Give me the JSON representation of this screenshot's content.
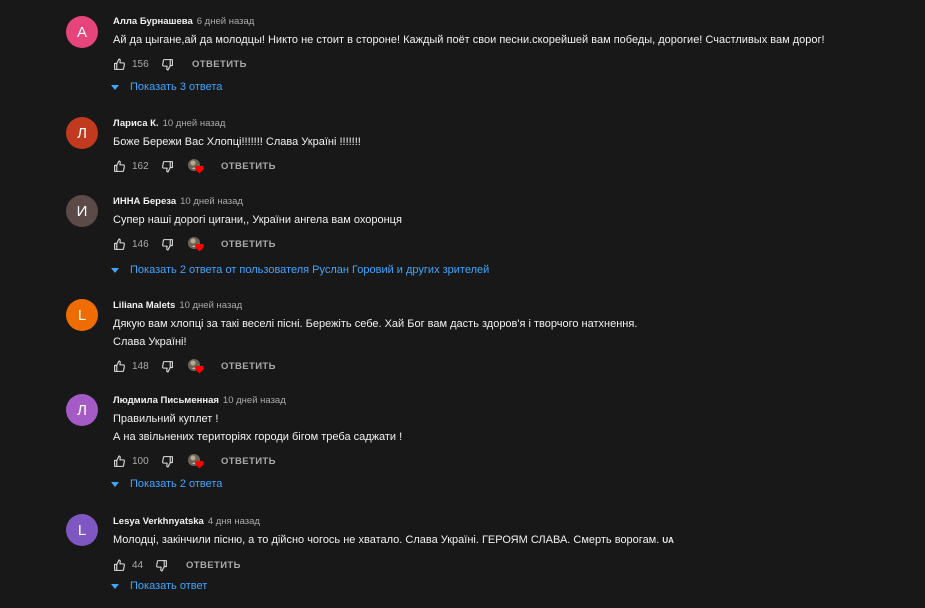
{
  "comments": [
    {
      "initial": "А",
      "avatar_color": "#e5457a",
      "author": "Алла Бурнашева",
      "time": "6 дней назад",
      "lines": [
        "Ай да цыгане,ай да молодцы!  Никто не стоит в стороне! Каждый поёт свои песни.скорейшей вам победы, дорогие! Счастливых вам дорог!"
      ],
      "likes": "156",
      "hearted": false,
      "reply_label": "ОТВЕТИТЬ",
      "show_replies": "Показать 3 ответа"
    },
    {
      "initial": "Л",
      "avatar_color": "#c1391f",
      "author": "Лариса К.",
      "time": "10 дней назад",
      "lines": [
        "Боже Бережи Вас Хлопці!!!!!!! Слава Україні !!!!!!!"
      ],
      "likes": "162",
      "hearted": true,
      "reply_label": "ОТВЕТИТЬ"
    },
    {
      "initial": "И",
      "avatar_color": "#5b4a47",
      "author": "ИННА Береза",
      "time": "10 дней назад",
      "lines": [
        "Супер наші дорогі цигани,, України ангела вам охоронця"
      ],
      "likes": "146",
      "hearted": true,
      "reply_label": "ОТВЕТИТЬ",
      "show_replies": "Показать 2 ответа от пользователя Руслан Горовий и других зрителей"
    },
    {
      "initial": "L",
      "avatar_color": "#ef6c00",
      "author": "Liliana Malets",
      "time": "10 дней назад",
      "lines": [
        "Дякую вам хлопці за такі веселі пісні.  Бережіть себе. Хай Бог вам дасть здоров'я і творчого натхнення.",
        "Слава Україні!"
      ],
      "likes": "148",
      "hearted": true,
      "reply_label": "ОТВЕТИТЬ"
    },
    {
      "initial": "Л",
      "avatar_color": "#a55bc6",
      "author": "Людмила Письменная",
      "time": "10 дней назад",
      "lines": [
        "Правильний куплет !",
        "А на звільнених територіях городи   бігом треба саджати  !"
      ],
      "likes": "100",
      "hearted": true,
      "reply_label": "ОТВЕТИТЬ",
      "show_replies": "Показать 2 ответа"
    },
    {
      "initial": "L",
      "avatar_color": "#7e57c2",
      "author": "Lesya Verkhnyatska",
      "time": "4 дня назад",
      "lines": [
        "Молодці, закінчили пісню, а то дійсно чогось не хватало. Слава Україні. ГЕРОЯМ СЛАВА. Смерть ворогам."
      ],
      "flag": "UA",
      "likes": "44",
      "hearted": false,
      "reply_label": "ОТВЕТИТЬ",
      "show_replies": "Показать ответ"
    }
  ]
}
